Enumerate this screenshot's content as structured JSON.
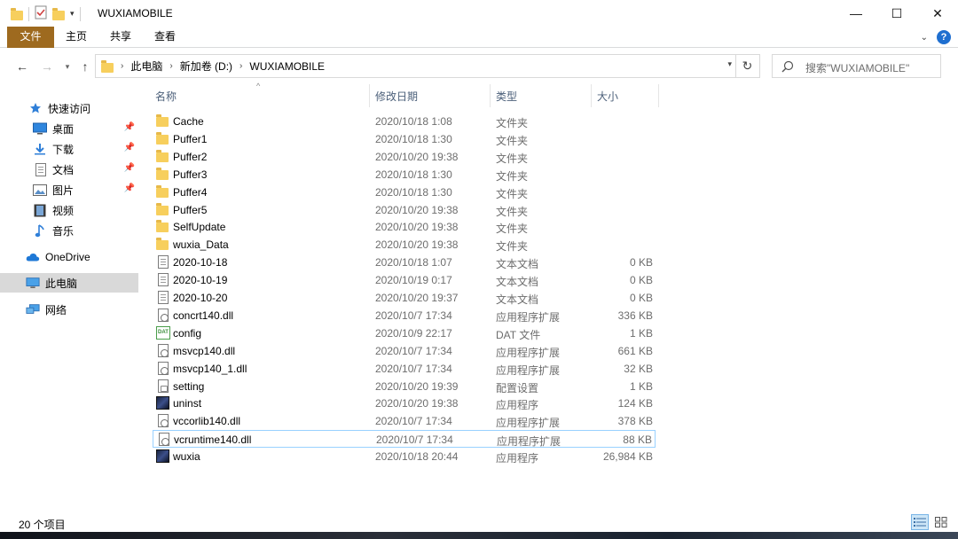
{
  "window": {
    "title": "WUXIAMOBILE",
    "controls": {
      "minimize": "—",
      "maximize": "☐",
      "close": "✕"
    }
  },
  "ribbon": {
    "file_tab": "文件",
    "tabs": [
      "主页",
      "共享",
      "查看"
    ],
    "help": "?"
  },
  "address": {
    "crumbs": [
      "此电脑",
      "新加卷 (D:)",
      "WUXIAMOBILE"
    ],
    "search_placeholder": "搜索\"WUXIAMOBILE\""
  },
  "navpane": {
    "items": [
      {
        "label": "快速访问",
        "icon": "star-icon",
        "pinned": false
      },
      {
        "label": "桌面",
        "icon": "desktop-icon",
        "pinned": true
      },
      {
        "label": "下载",
        "icon": "download-icon",
        "pinned": true
      },
      {
        "label": "文档",
        "icon": "document-icon",
        "pinned": true
      },
      {
        "label": "图片",
        "icon": "pictures-icon",
        "pinned": true
      },
      {
        "label": "视频",
        "icon": "video-icon",
        "pinned": false
      },
      {
        "label": "音乐",
        "icon": "music-icon",
        "pinned": false
      },
      {
        "label": "OneDrive",
        "icon": "onedrive-icon",
        "pinned": false
      },
      {
        "label": "此电脑",
        "icon": "this-pc-icon",
        "pinned": false,
        "selected": true
      },
      {
        "label": "网络",
        "icon": "network-icon",
        "pinned": false
      }
    ]
  },
  "columns": {
    "name": "名称",
    "date": "修改日期",
    "type": "类型",
    "size": "大小"
  },
  "files": [
    {
      "name": "Cache",
      "date": "2020/10/18 1:08",
      "type": "文件夹",
      "size": "",
      "icon": "folder-icon"
    },
    {
      "name": "Puffer1",
      "date": "2020/10/18 1:30",
      "type": "文件夹",
      "size": "",
      "icon": "folder-icon"
    },
    {
      "name": "Puffer2",
      "date": "2020/10/20 19:38",
      "type": "文件夹",
      "size": "",
      "icon": "folder-icon"
    },
    {
      "name": "Puffer3",
      "date": "2020/10/18 1:30",
      "type": "文件夹",
      "size": "",
      "icon": "folder-icon"
    },
    {
      "name": "Puffer4",
      "date": "2020/10/18 1:30",
      "type": "文件夹",
      "size": "",
      "icon": "folder-icon"
    },
    {
      "name": "Puffer5",
      "date": "2020/10/20 19:38",
      "type": "文件夹",
      "size": "",
      "icon": "folder-icon"
    },
    {
      "name": "SelfUpdate",
      "date": "2020/10/20 19:38",
      "type": "文件夹",
      "size": "",
      "icon": "folder-icon"
    },
    {
      "name": "wuxia_Data",
      "date": "2020/10/20 19:38",
      "type": "文件夹",
      "size": "",
      "icon": "folder-icon"
    },
    {
      "name": "2020-10-18",
      "date": "2020/10/18 1:07",
      "type": "文本文档",
      "size": "0 KB",
      "icon": "text-file-icon"
    },
    {
      "name": "2020-10-19",
      "date": "2020/10/19 0:17",
      "type": "文本文档",
      "size": "0 KB",
      "icon": "text-file-icon"
    },
    {
      "name": "2020-10-20",
      "date": "2020/10/20 19:37",
      "type": "文本文档",
      "size": "0 KB",
      "icon": "text-file-icon"
    },
    {
      "name": "concrt140.dll",
      "date": "2020/10/7 17:34",
      "type": "应用程序扩展",
      "size": "336 KB",
      "icon": "dll-file-icon"
    },
    {
      "name": "config",
      "date": "2020/10/9 22:17",
      "type": "DAT 文件",
      "size": "1 KB",
      "icon": "dat-file-icon"
    },
    {
      "name": "msvcp140.dll",
      "date": "2020/10/7 17:34",
      "type": "应用程序扩展",
      "size": "661 KB",
      "icon": "dll-file-icon"
    },
    {
      "name": "msvcp140_1.dll",
      "date": "2020/10/7 17:34",
      "type": "应用程序扩展",
      "size": "32 KB",
      "icon": "dll-file-icon"
    },
    {
      "name": "setting",
      "date": "2020/10/20 19:39",
      "type": "配置设置",
      "size": "1 KB",
      "icon": "config-file-icon"
    },
    {
      "name": "uninst",
      "date": "2020/10/20 19:38",
      "type": "应用程序",
      "size": "124 KB",
      "icon": "app-icon"
    },
    {
      "name": "vccorlib140.dll",
      "date": "2020/10/7 17:34",
      "type": "应用程序扩展",
      "size": "378 KB",
      "icon": "dll-file-icon"
    },
    {
      "name": "vcruntime140.dll",
      "date": "2020/10/7 17:34",
      "type": "应用程序扩展",
      "size": "88 KB",
      "icon": "dll-file-icon",
      "focused": true
    },
    {
      "name": "wuxia",
      "date": "2020/10/18 20:44",
      "type": "应用程序",
      "size": "26,984 KB",
      "icon": "app-icon"
    }
  ],
  "status": {
    "count": "20 个项目"
  },
  "colors": {
    "file_tab": "#9e6a1f",
    "selection": "#d9d9d9",
    "focus_border": "#99d1ff",
    "header_text": "#4c607a"
  }
}
